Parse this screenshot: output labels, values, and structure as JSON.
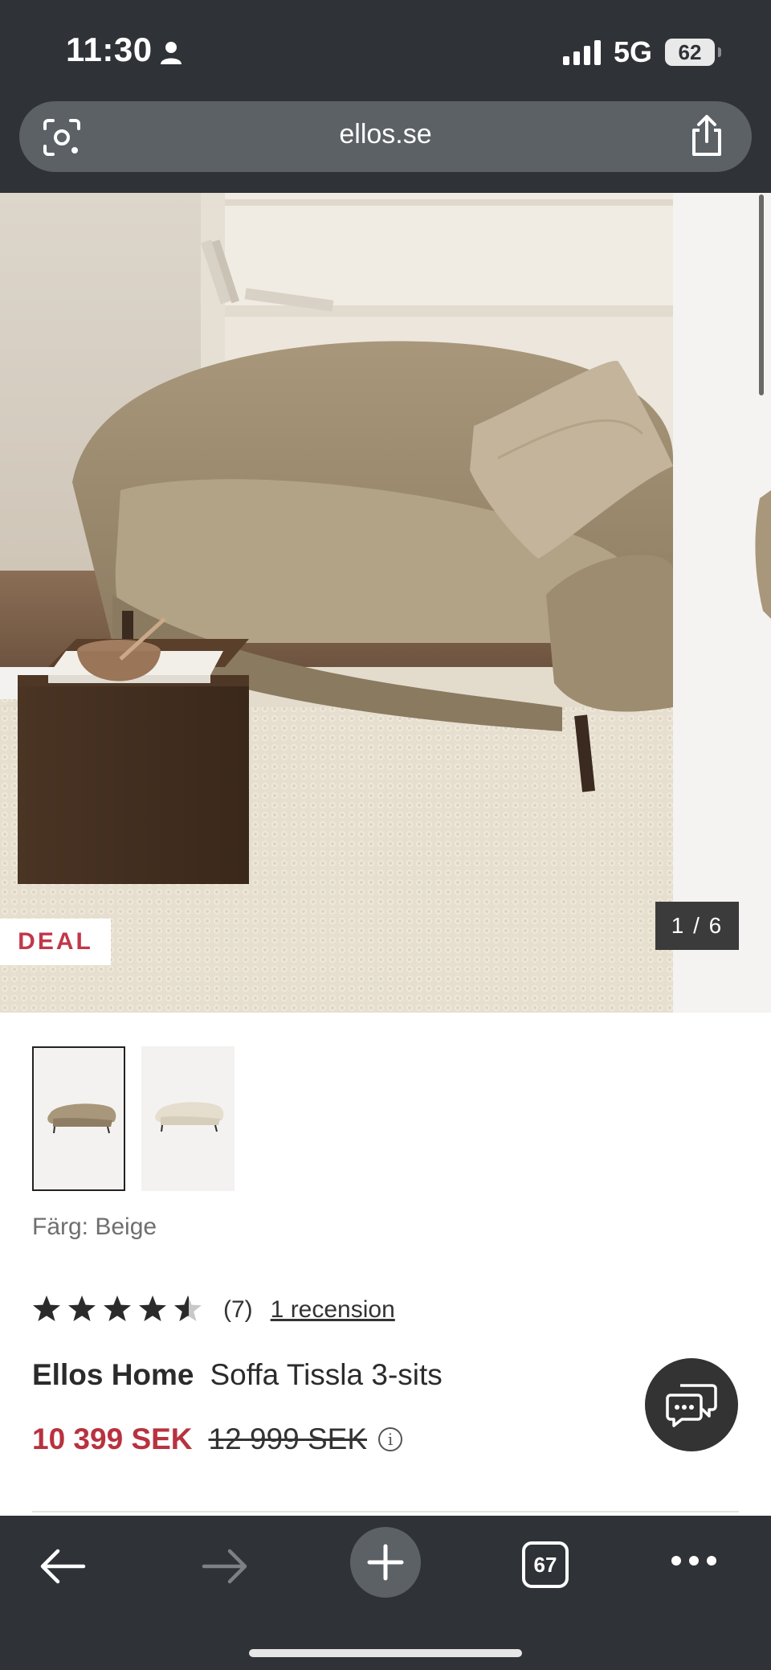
{
  "status_bar": {
    "time": "11:30",
    "network": "5G",
    "battery": "62"
  },
  "browser": {
    "url": "ellos.se",
    "tab_count": "67"
  },
  "gallery": {
    "badge": "DEAL",
    "counter": "1 / 6"
  },
  "product": {
    "color_label": "Färg: Beige",
    "rating": 4.5,
    "review_count": "(7)",
    "reviews_link": "1 recension",
    "brand": "Ellos Home",
    "name": "Soffa Tissla 3-sits",
    "price_current": "10 399 SEK",
    "price_old": "12 999 SEK"
  },
  "colors": {
    "sale_red": "#b8323f",
    "toolbar_bg": "#2f3236"
  }
}
